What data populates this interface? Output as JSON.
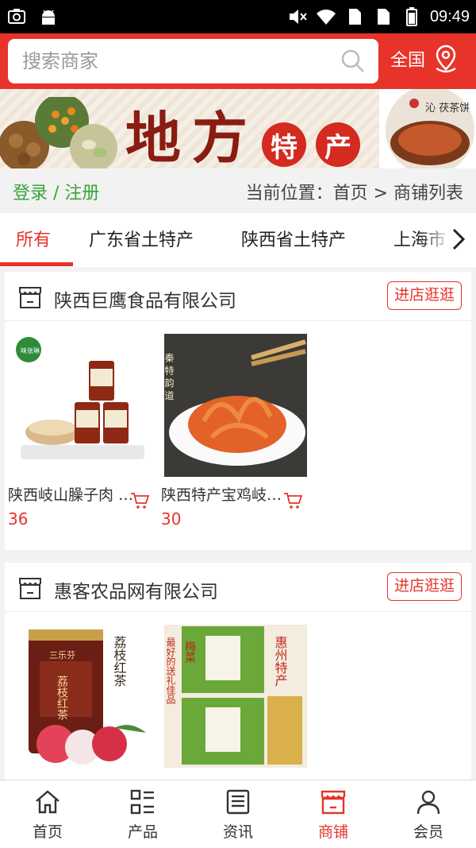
{
  "status_bar": {
    "time": "09:49"
  },
  "header": {
    "search_placeholder": "搜索商家",
    "region_label": "全国"
  },
  "banner": {
    "title": "地方",
    "seal_1": "特",
    "seal_2": "产",
    "right_caption": "沁 茯茶饼"
  },
  "location_bar": {
    "login_label": "登录 / 注册",
    "breadcrumb": "当前位置：首页 > 商铺列表"
  },
  "tabs": [
    {
      "label": "所有"
    },
    {
      "label": "广东省土特产"
    },
    {
      "label": "陕西省土特产"
    },
    {
      "label": "上海市"
    }
  ],
  "shops": [
    {
      "name": "陕西巨鹰食品有限公司",
      "visit_label": "进店逛逛",
      "products": [
        {
          "name": "陕西岐山臊子肉 …",
          "price": "36"
        },
        {
          "name": "陕西特产宝鸡岐…",
          "price": "30"
        }
      ]
    },
    {
      "name": "惠客农品网有限公司",
      "visit_label": "进店逛逛",
      "products": [
        {
          "name": "",
          "price": ""
        },
        {
          "name": "",
          "price": ""
        }
      ]
    }
  ],
  "image_text": {
    "jar_badge": "味张琳",
    "noodle_side": "秦 特 韵 道",
    "tea_brand": "三乐芬",
    "tea_can": "荔枝红茶",
    "tea_side": "荔枝红茶",
    "gift_side": "惠州特产",
    "gift_left": "最好的送礼佳品",
    "gift_box": "梅菜"
  },
  "bottom_nav": [
    {
      "label": "首页",
      "icon": "home-icon"
    },
    {
      "label": "产品",
      "icon": "list-icon"
    },
    {
      "label": "资讯",
      "icon": "news-icon"
    },
    {
      "label": "商铺",
      "icon": "shop-icon",
      "active": true
    },
    {
      "label": "会员",
      "icon": "user-icon"
    }
  ],
  "colors": {
    "accent": "#e8332a",
    "login_green": "#3aa33a",
    "status_bar": "#000000"
  }
}
